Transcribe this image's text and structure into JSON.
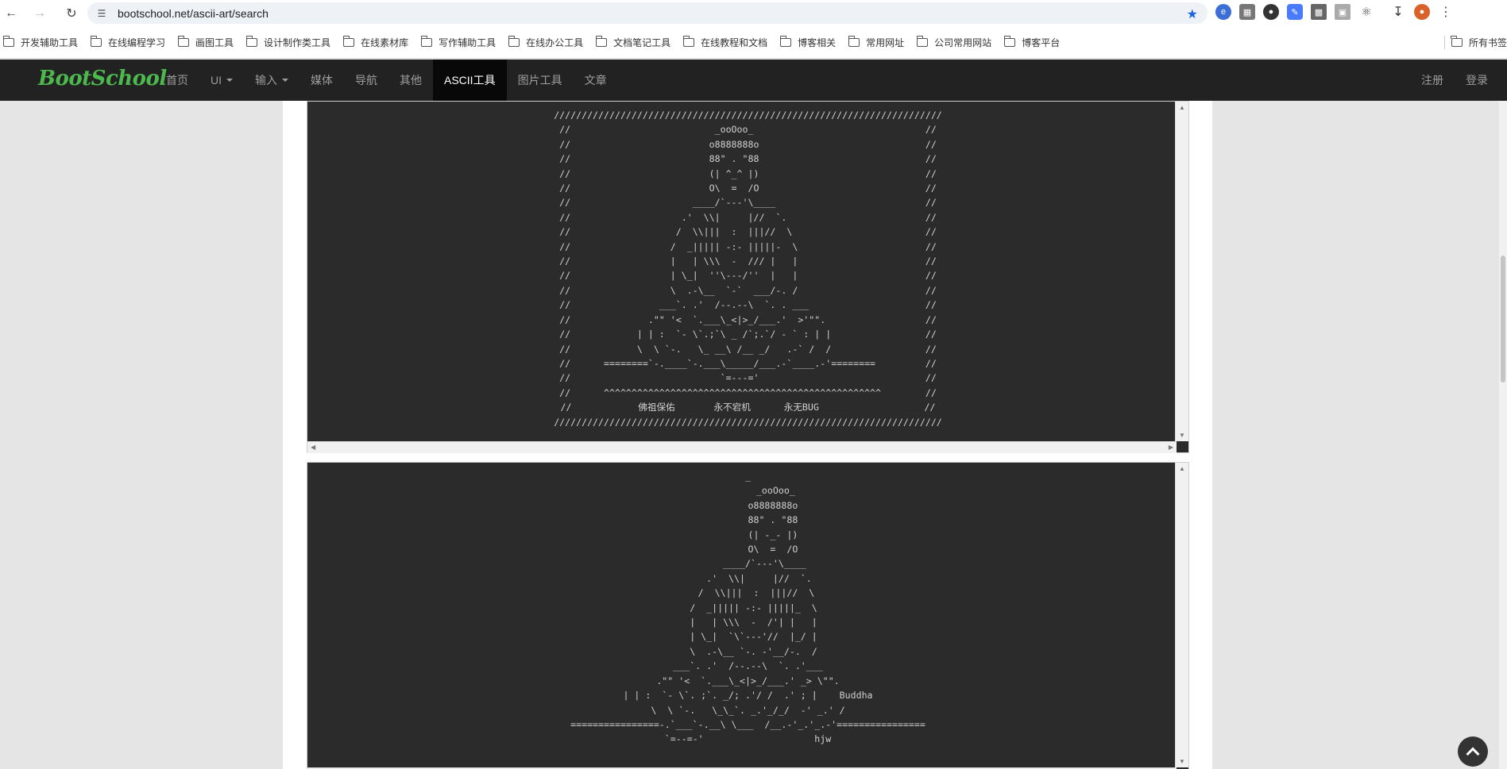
{
  "browser": {
    "url": "bootschool.net/ascii-art/search"
  },
  "bookmarks": [
    {
      "label": "开发辅助工具"
    },
    {
      "label": "在线编程学习"
    },
    {
      "label": "画图工具"
    },
    {
      "label": "设计制作类工具"
    },
    {
      "label": "在线素材库"
    },
    {
      "label": "写作辅助工具"
    },
    {
      "label": "在线办公工具"
    },
    {
      "label": "文档笔记工具"
    },
    {
      "label": "在线教程和文档"
    },
    {
      "label": "博客相关"
    },
    {
      "label": "常用网址"
    },
    {
      "label": "公司常用网站"
    },
    {
      "label": "博客平台"
    }
  ],
  "bookmarks_right": "所有书签",
  "site": {
    "brand": "BootSchool",
    "nav": {
      "home": "首页",
      "ui": "UI",
      "input": "输入",
      "media": "媒体",
      "navigation": "导航",
      "other": "其他",
      "ascii": "ASCII工具",
      "image": "图片工具",
      "article": "文章"
    },
    "register": "注册",
    "login": "登录"
  },
  "art": {
    "first": "//////////////////////////////////////////////////////////////////////\n//                          _ooOoo_                               //\n//                         o8888888o                              //\n//                         88\" . \"88                              //\n//                         (| ^_^ |)                              //\n//                         O\\  =  /O                              //\n//                      ____/`---'\\____                           //\n//                    .'  \\\\|     |//  `.                         //\n//                   /  \\\\|||  :  |||//  \\                        //\n//                  /  _||||| -:- |||||-  \\                       //\n//                  |   | \\\\\\  -  /// |   |                       //\n//                  | \\_|  ''\\---/''  |   |                       //\n//                  \\  .-\\__  `-`  ___/-. /                       //\n//                ___`. .'  /--.--\\  `. . ___                     //\n//              .\"\" '<  `.___\\_<|>_/___.'  >'\"\".                  //\n//            | | :  `- \\`.;`\\ _ /`;.`/ - ` : | |                 //\n//            \\  \\ `-.   \\_ __\\ /__ _/   .-` /  /                 //\n//      ========`-.____`-.___\\_____/___.-`____.-'========         //\n//                           `=---='                              //\n//      ^^^^^^^^^^^^^^^^^^^^^^^^^^^^^^^^^^^^^^^^^^^^^^^^^^        //\n//            佛祖保佑       永不宕机      永无BUG                   //\n//////////////////////////////////////////////////////////////////////",
    "second": "_\n          _ooOoo_\n         o8888888o\n         88\" . \"88\n         (| -_- |)\n         O\\  =  /O\n      ____/`---'\\____\n    .'  \\\\|     |//  `.\n   /  \\\\|||  :  |||//  \\\n  /  _||||| -:- |||||_  \\\n  |   | \\\\\\  -  /'| |   |\n  | \\_|  `\\`---'//  |_/ |\n  \\  .-\\__ `-. -'__/-.  /\n___`. .'  /--.--\\  `. .'___\n.\"\" '<  `.___\\_<|>_/___.' _> \\\"\".\n| | :  `- \\`. ;`. _/; .'/ /  .' ; |    Buddha\n\\  \\ `-.   \\_\\_`. _.'_/_/  -' _.' /\n================-.`___`-.__\\ \\___  /__.-'_.'_.-'================\n`=--=-'                    hjw"
  }
}
